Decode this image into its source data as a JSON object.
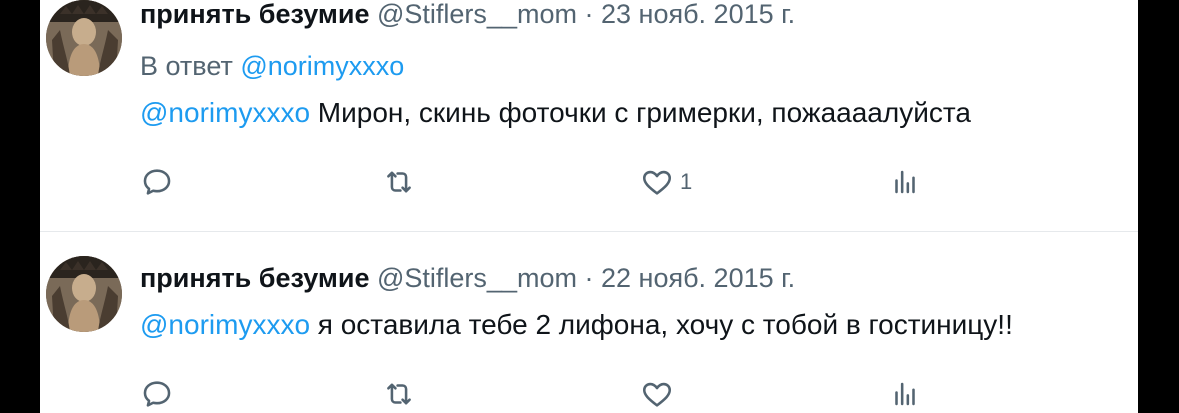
{
  "tweets": [
    {
      "display_name": "принять безумие",
      "handle": "@Stiflers__mom",
      "separator": "·",
      "date": "23 нояб. 2015 г.",
      "reply_prefix": "В ответ",
      "reply_to": "@norimyxxxo",
      "mention": "@norimyxxxo",
      "text": " Мирон, скинь фоточки с гримерки, пожаааалуйста",
      "likes": "1"
    },
    {
      "display_name": "принять безумие",
      "handle": "@Stiflers__mom",
      "separator": "·",
      "date": "22 нояб. 2015 г.",
      "mention": "@norimyxxxo",
      "text": " я оставила тебе 2 лифона, хочу с тобой в гостиницу!!"
    }
  ],
  "icons": [
    "reply-icon",
    "retweet-icon",
    "like-icon",
    "views-icon"
  ],
  "colors": {
    "link": "#1d9bf0",
    "muted": "#536471",
    "text": "#0f1419",
    "background": "#ffffff",
    "frame": "#000000"
  }
}
